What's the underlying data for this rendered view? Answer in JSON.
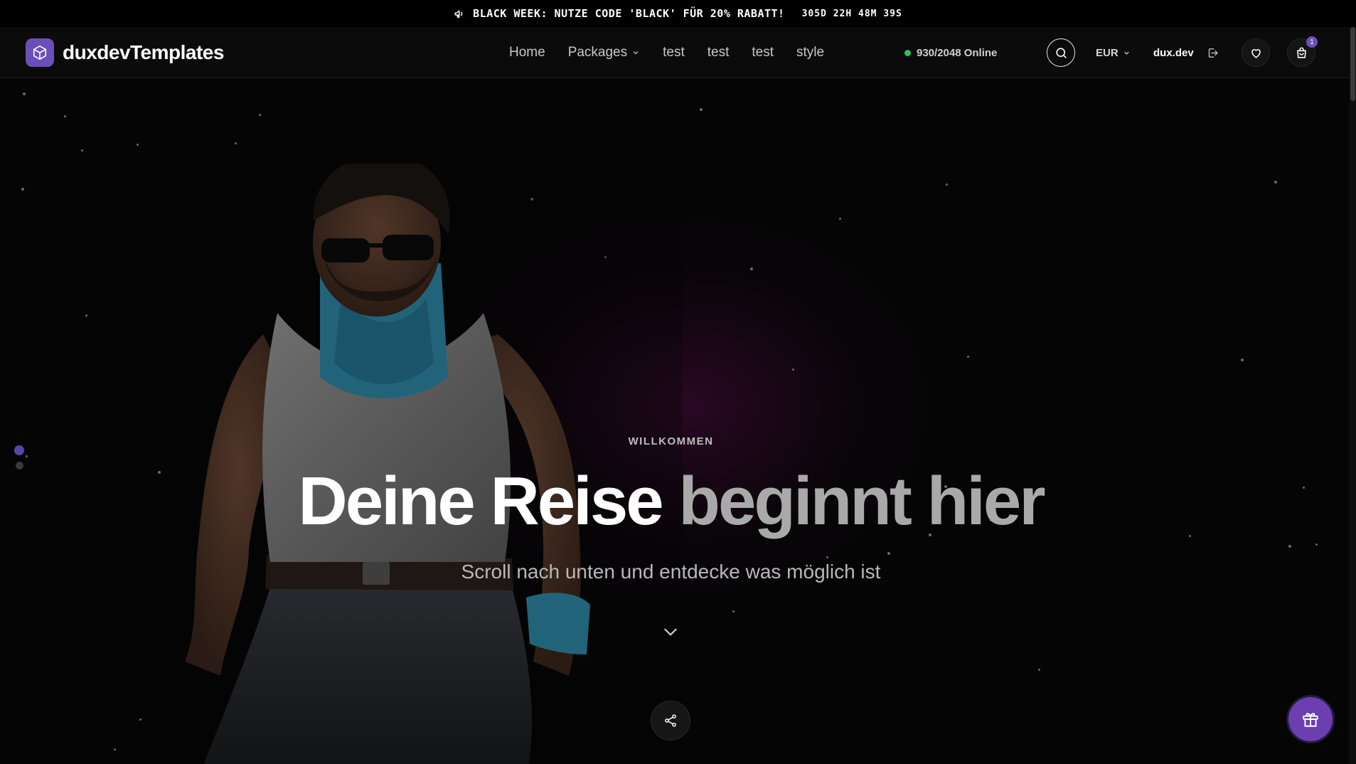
{
  "announcement": {
    "icon": "megaphone-icon",
    "text": "BLACK WEEK: NUTZE CODE 'BLACK' FÜR 20% RABATT!",
    "countdown": "305D 22H 48M 39S"
  },
  "header": {
    "logo_text": "duxdevTemplates",
    "logo_icon": "cube-icon",
    "nav": [
      {
        "label": "Home"
      },
      {
        "label": "Packages"
      },
      {
        "label": "test"
      },
      {
        "label": "test"
      },
      {
        "label": "test"
      },
      {
        "label": "style"
      }
    ],
    "online_status": "930/2048 Online",
    "currency": "EUR",
    "username": "dux.dev",
    "cart_count": "1"
  },
  "hero": {
    "eyebrow": "WILLKOMMEN",
    "headline_primary": "Deine Reise",
    "headline_secondary": "beginnt hier",
    "subline": "Scroll nach unten und entdecke was möglich ist"
  },
  "colors": {
    "accent": "#6b4fb8",
    "online": "#22c55e",
    "background": "#050505"
  }
}
